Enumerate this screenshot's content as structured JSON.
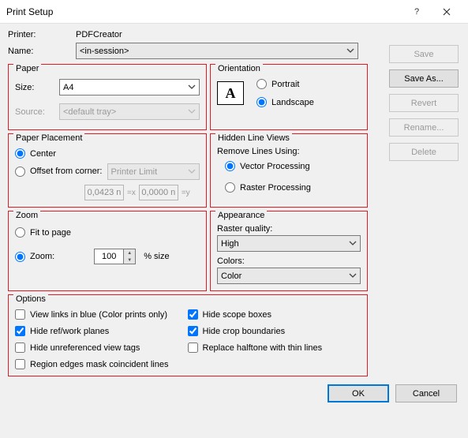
{
  "title": "Print Setup",
  "printer": {
    "label": "Printer:",
    "value": "PDFCreator"
  },
  "name": {
    "label": "Name:",
    "value": "<in-session>"
  },
  "buttons": {
    "save": "Save",
    "saveAs": "Save As...",
    "revert": "Revert",
    "rename": "Rename...",
    "delete": "Delete",
    "ok": "OK",
    "cancel": "Cancel"
  },
  "paper": {
    "legend": "Paper",
    "sizeLabel": "Size:",
    "sizeValue": "A4",
    "sourceLabel": "Source:",
    "sourceValue": "<default tray>"
  },
  "orientation": {
    "legend": "Orientation",
    "portrait": "Portrait",
    "landscape": "Landscape"
  },
  "placement": {
    "legend": "Paper Placement",
    "center": "Center",
    "offset": "Offset from corner:",
    "limit": "Printer Limit",
    "x": "0,0423 n",
    "xeq": "=x",
    "y": "0,0000 n",
    "yeq": "=y"
  },
  "hidden": {
    "legend": "Hidden Line Views",
    "remove": "Remove Lines Using:",
    "vector": "Vector Processing",
    "raster": "Raster Processing"
  },
  "zoom": {
    "legend": "Zoom",
    "fit": "Fit to page",
    "zoom": "Zoom:",
    "value": "100",
    "pct": "% size"
  },
  "appearance": {
    "legend": "Appearance",
    "rq": "Raster quality:",
    "rqv": "High",
    "colors": "Colors:",
    "colorsv": "Color"
  },
  "options": {
    "legend": "Options",
    "c1": "View links in blue (Color prints only)",
    "c2": "Hide ref/work planes",
    "c3": "Hide unreferenced view tags",
    "c4": "Region edges mask coincident lines",
    "c5": "Hide scope boxes",
    "c6": "Hide crop boundaries",
    "c7": "Replace halftone with thin lines"
  }
}
